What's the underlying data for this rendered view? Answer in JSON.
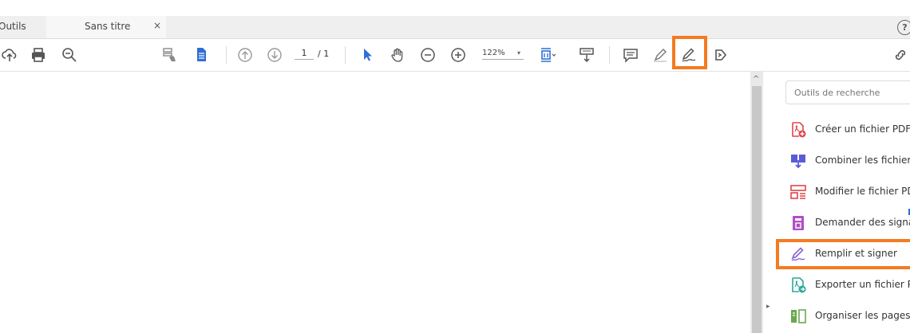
{
  "tabs": {
    "tools_label": "Outils",
    "document_label": "Sans titre",
    "close_symbol": "×",
    "help_symbol": "?"
  },
  "toolbar": {
    "icons": [
      "upload-cloud-icon",
      "print-icon",
      "zoom-search-icon",
      "scan-hand-icon",
      "document-icon",
      "page-up-icon",
      "page-down-icon",
      "select-arrow-icon",
      "hand-icon",
      "zoom-out-icon",
      "zoom-in-icon",
      "fit-page-icon",
      "scroll-mode-icon",
      "comment-icon",
      "highlight-pen-icon",
      "fill-sign-icon",
      "stamp-icon",
      "share-link-icon"
    ],
    "current_page": "1",
    "total_pages": "/ 1",
    "zoom_level": "122%",
    "zoom_caret": "▾",
    "highlight_color": "#f47b20"
  },
  "right_panel": {
    "search_placeholder": "Outils de recherche",
    "tools": [
      {
        "label": "Créer un fichier PDF",
        "icon": "create-pdf-icon",
        "color": "#e1464b"
      },
      {
        "label": "Combiner les fichiers",
        "icon": "combine-files-icon",
        "color": "#5b5bd8"
      },
      {
        "label": "Modifier le fichier PDF",
        "icon": "edit-pdf-icon",
        "color": "#e1464b"
      },
      {
        "label": "Demander des signatures",
        "icon": "request-signatures-icon",
        "color": "#b04fc7"
      },
      {
        "label": "Remplir et signer",
        "icon": "fill-sign-icon",
        "color": "#8a63d2"
      },
      {
        "label": "Exporter un fichier PDF",
        "icon": "export-pdf-icon",
        "color": "#2aa89a"
      },
      {
        "label": "Organiser les pages",
        "icon": "organize-pages-icon",
        "color": "#6aa84f"
      }
    ]
  },
  "scroll": {
    "up_symbol": "^",
    "collapse_symbol": "▸"
  }
}
